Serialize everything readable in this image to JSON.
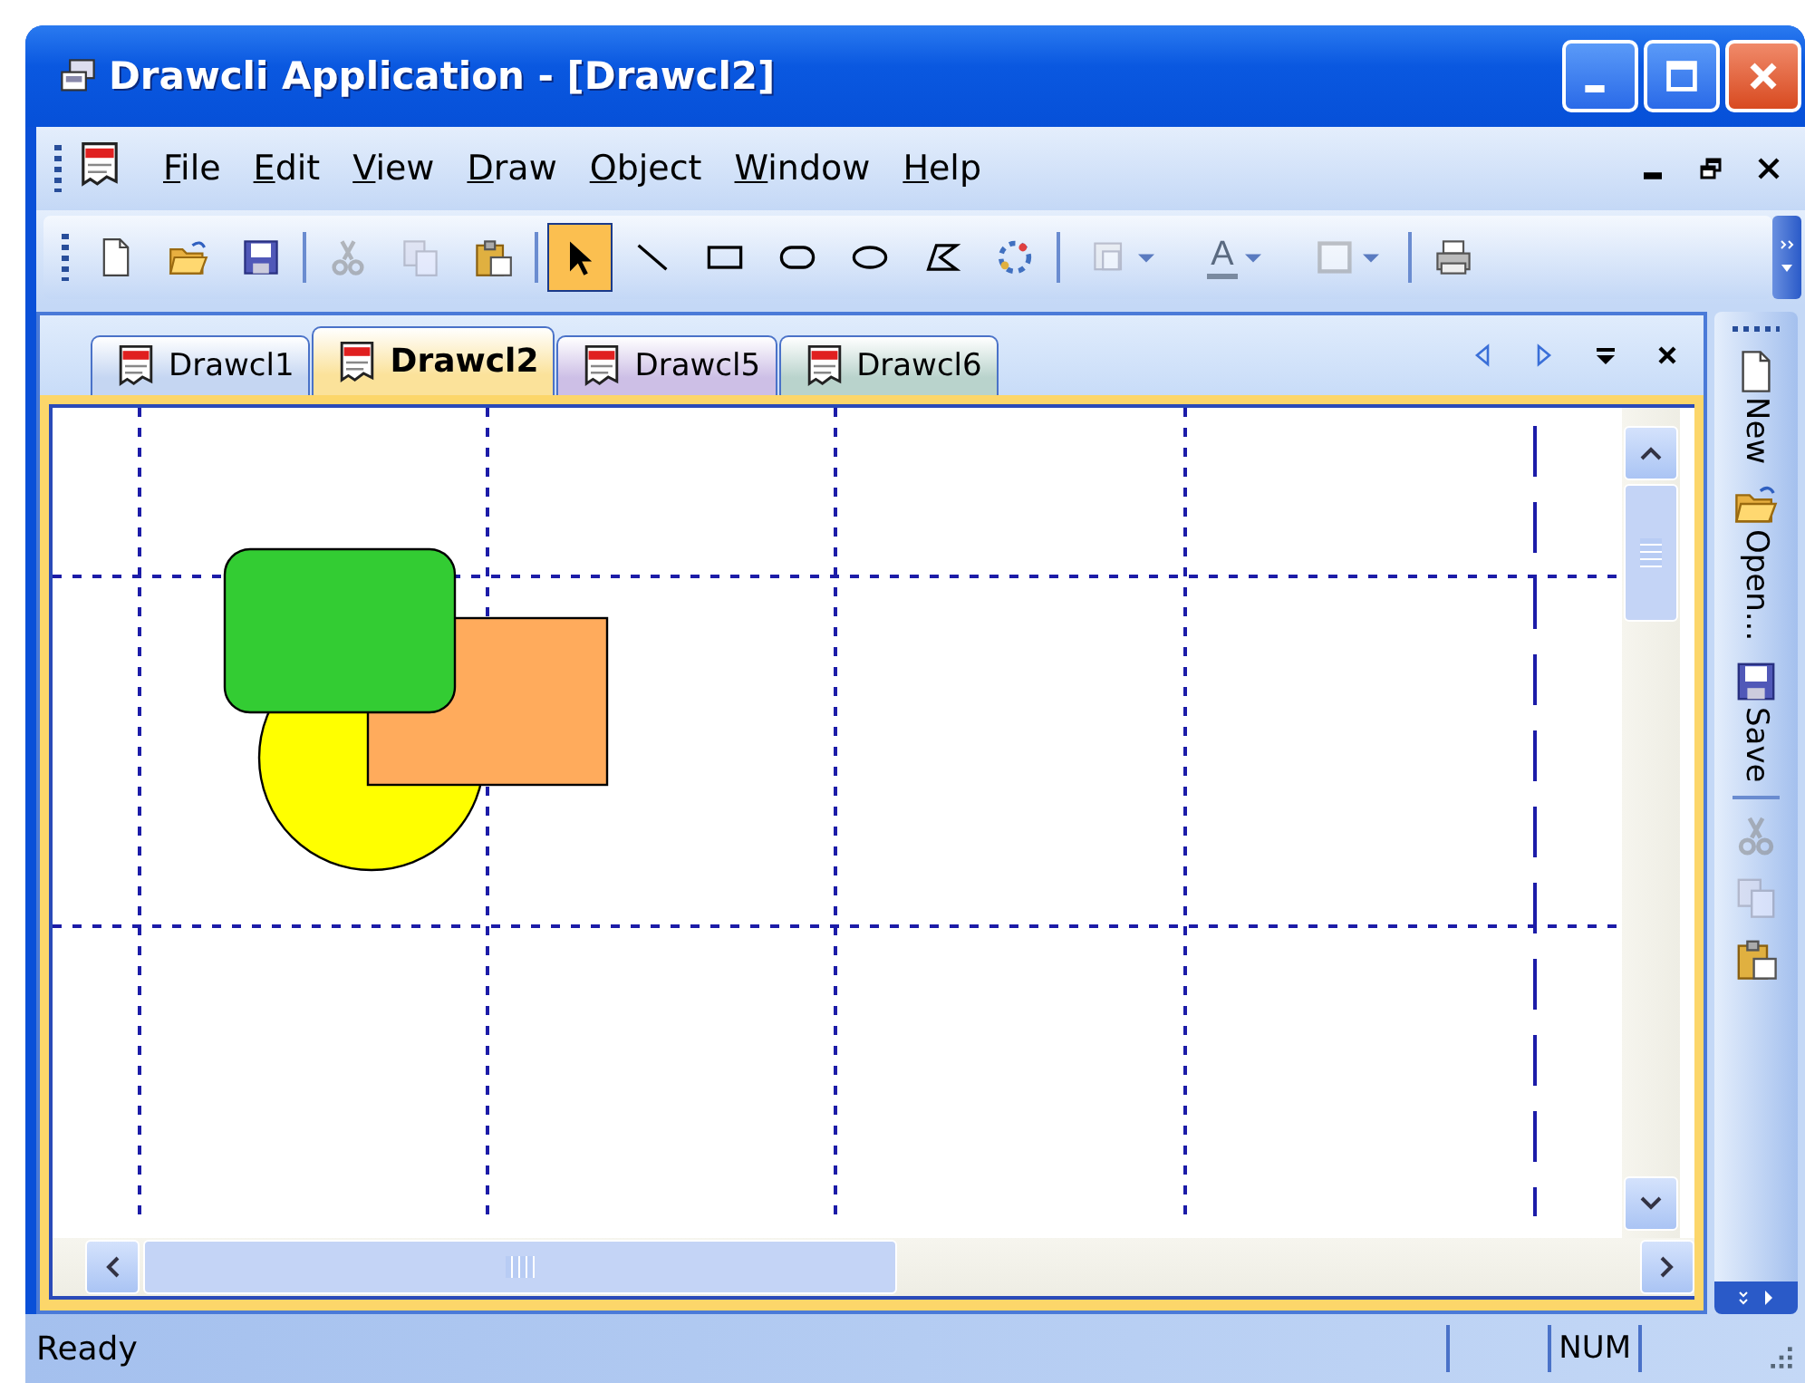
{
  "window": {
    "title": "Drawcli Application - [Drawcl2]"
  },
  "menu_bar": {
    "items": [
      "File",
      "Edit",
      "View",
      "Draw",
      "Object",
      "Window",
      "Help"
    ]
  },
  "toolbar": [
    {
      "kind": "new",
      "disabled": false,
      "selected": false
    },
    {
      "kind": "open",
      "disabled": false,
      "selected": false
    },
    {
      "kind": "save",
      "disabled": false,
      "selected": false
    },
    {
      "kind": "separator"
    },
    {
      "kind": "cut",
      "disabled": true,
      "selected": false
    },
    {
      "kind": "copy",
      "disabled": true,
      "selected": false
    },
    {
      "kind": "paste",
      "disabled": false,
      "selected": false
    },
    {
      "kind": "separator"
    },
    {
      "kind": "select",
      "disabled": false,
      "selected": true
    },
    {
      "kind": "line",
      "disabled": false,
      "selected": false
    },
    {
      "kind": "rectangle",
      "disabled": false,
      "selected": false
    },
    {
      "kind": "roundrect",
      "disabled": false,
      "selected": false
    },
    {
      "kind": "ellipse",
      "disabled": false,
      "selected": false
    },
    {
      "kind": "polygon",
      "disabled": false,
      "selected": false
    },
    {
      "kind": "properties",
      "disabled": false,
      "selected": false
    },
    {
      "kind": "separator"
    },
    {
      "kind": "page",
      "disabled": true,
      "selected": false,
      "dropdown": true
    },
    {
      "kind": "fontcolor",
      "label": "A",
      "disabled": true,
      "selected": false,
      "dropdown": true
    },
    {
      "kind": "border",
      "disabled": true,
      "selected": false,
      "dropdown": true
    },
    {
      "kind": "separator"
    },
    {
      "kind": "print",
      "disabled": false,
      "selected": false
    }
  ],
  "tabs": [
    {
      "label": "Drawcl1",
      "selected": false,
      "color": "#c5d6f2"
    },
    {
      "label": "Drawcl2",
      "selected": true,
      "color": "#fbe29a"
    },
    {
      "label": "Drawcl5",
      "selected": false,
      "color": "#cdbfe6"
    },
    {
      "label": "Drawcl6",
      "selected": false,
      "color": "#b9d3cc"
    }
  ],
  "side_toolbar": [
    {
      "kind": "new",
      "label": "New",
      "disabled": false
    },
    {
      "kind": "open",
      "label": "Open...",
      "disabled": false
    },
    {
      "kind": "save",
      "label": "Save",
      "disabled": false
    },
    {
      "kind": "separator"
    },
    {
      "kind": "cut",
      "disabled": true
    },
    {
      "kind": "copy",
      "disabled": true
    },
    {
      "kind": "paste",
      "disabled": false
    }
  ],
  "status_bar": {
    "message": "Ready",
    "indicator": "NUM"
  }
}
